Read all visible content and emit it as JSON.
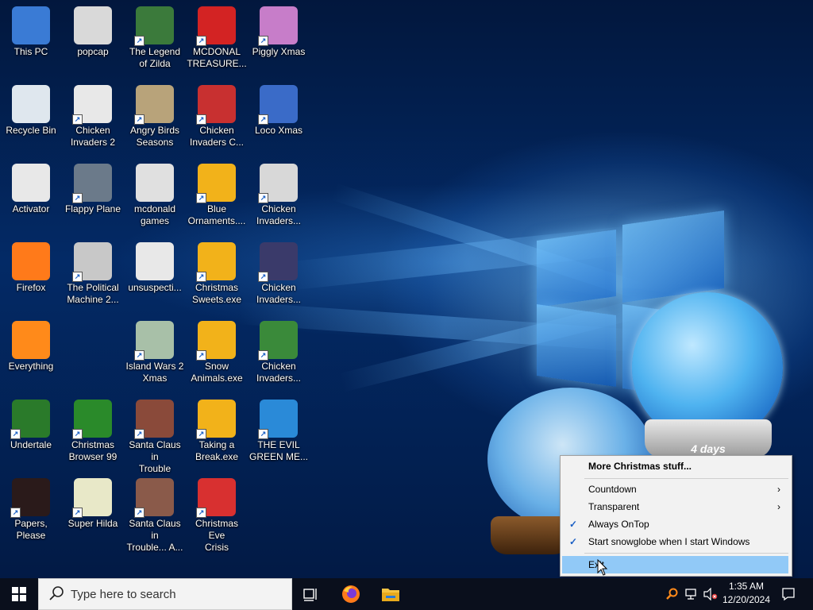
{
  "desktop": {
    "icons": [
      {
        "label": "This PC",
        "icon": "computer-icon",
        "color": "#3a7bd5"
      },
      {
        "label": "popcap",
        "icon": "folder-icon",
        "color": "#d9d9d9"
      },
      {
        "label": "The Legend\nof Zilda",
        "icon": "game-icon",
        "color": "#3b7a3b"
      },
      {
        "label": "MCDONAL\nTREASURE...",
        "icon": "mcdonalds-icon",
        "color": "#d32323"
      },
      {
        "label": "Piggly Xmas",
        "icon": "pig-icon",
        "color": "#c77dc9"
      },
      {
        "label": "Recycle Bin",
        "icon": "recycle-bin-icon",
        "color": "#dfe7ee"
      },
      {
        "label": "Chicken\nInvaders 2",
        "icon": "chicken-icon",
        "color": "#e8e8e8"
      },
      {
        "label": "Angry Birds\nSeasons",
        "icon": "angry-birds-icon",
        "color": "#b8a37a"
      },
      {
        "label": "Chicken\nInvaders C...",
        "icon": "chicken-icon",
        "color": "#c83030"
      },
      {
        "label": "Loco Xmas",
        "icon": "bear-icon",
        "color": "#3a6bc8"
      },
      {
        "label": "Activator",
        "icon": "file-icon",
        "color": "#e8e8e8"
      },
      {
        "label": "Flappy Plane",
        "icon": "plane-icon",
        "color": "#6b7a8a"
      },
      {
        "label": "mcdonald\ngames",
        "icon": "folder-icon",
        "color": "#e0e0e0"
      },
      {
        "label": "Blue\nOrnaments....",
        "icon": "puzzle-icon",
        "color": "#f2b21a"
      },
      {
        "label": "Chicken\nInvaders...",
        "icon": "chicken-icon",
        "color": "#d8d8d8"
      },
      {
        "label": "Firefox",
        "icon": "firefox-icon",
        "color": "#ff7a1a"
      },
      {
        "label": "The Political\nMachine 2...",
        "icon": "political-icon",
        "color": "#c8c8c8"
      },
      {
        "label": "unsuspecti...",
        "icon": "file-icon",
        "color": "#e8e8e8"
      },
      {
        "label": "Christmas\nSweets.exe",
        "icon": "puzzle-icon",
        "color": "#f2b21a"
      },
      {
        "label": "Chicken\nInvaders...",
        "icon": "chicken-icon",
        "color": "#3a3a6a"
      },
      {
        "label": "Everything",
        "icon": "search-icon",
        "color": "#ff8a1a"
      },
      {
        "label": "",
        "icon": "",
        "color": ""
      },
      {
        "label": "Island Wars 2\nXmas",
        "icon": "island-icon",
        "color": "#a8c0a8"
      },
      {
        "label": "Snow\nAnimals.exe",
        "icon": "puzzle-icon",
        "color": "#f2b21a"
      },
      {
        "label": "Chicken\nInvaders...",
        "icon": "chicken-icon",
        "color": "#3a8a3a"
      },
      {
        "label": "Undertale",
        "icon": "undertale-icon",
        "color": "#2a7a2a"
      },
      {
        "label": "Christmas\nBrowser 99",
        "icon": "tree-icon",
        "color": "#2a8a2a"
      },
      {
        "label": "Santa Claus in\nTrouble",
        "icon": "santa-icon",
        "color": "#8a4a3a"
      },
      {
        "label": "Taking a\nBreak.exe",
        "icon": "puzzle-icon",
        "color": "#f2b21a"
      },
      {
        "label": "THE EVIL\nGREEN ME...",
        "icon": "messenger-icon",
        "color": "#2a8ad8"
      },
      {
        "label": "Papers, Please",
        "icon": "papers-please-icon",
        "color": "#2a1a1a"
      },
      {
        "label": "Super Hilda",
        "icon": "pixel-icon",
        "color": "#e8e8c8"
      },
      {
        "label": "Santa Claus in\nTrouble... A...",
        "icon": "santa-icon",
        "color": "#8a5a4a"
      },
      {
        "label": "Christmas Eve\nCrisis",
        "icon": "santa-face-icon",
        "color": "#d83030"
      }
    ]
  },
  "snowglobe": {
    "countdown_label": "4 days",
    "small_label": "4"
  },
  "context_menu": {
    "items": [
      {
        "label": "More Christmas stuff...",
        "bold": true
      },
      {
        "label": "Countdown",
        "submenu": true
      },
      {
        "label": "Transparent",
        "submenu": true
      },
      {
        "label": "Always OnTop",
        "checked": true
      },
      {
        "label": "Start snowglobe when I start Windows",
        "checked": true
      },
      {
        "label": "Exit",
        "highlighted": true
      }
    ]
  },
  "taskbar": {
    "search_placeholder": "Type here to search",
    "time": "1:35 AM",
    "date": "12/20/2024",
    "accent": "#91c9f7"
  }
}
